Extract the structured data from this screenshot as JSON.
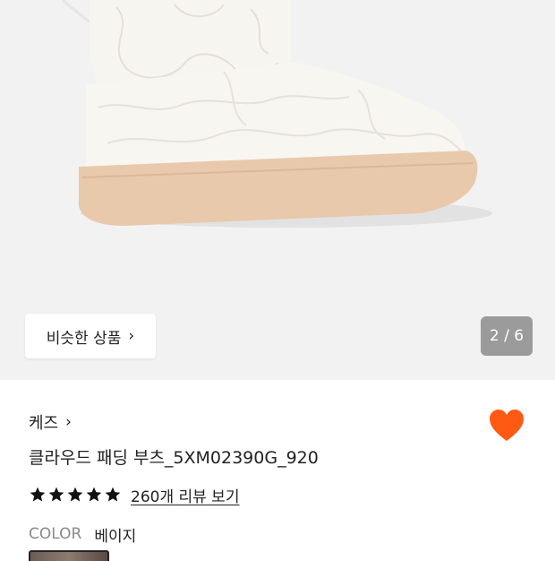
{
  "gallery": {
    "similar_button_label": "비슷한 상품",
    "pager_text": "2 / 6",
    "current_image": 2,
    "total_images": 6
  },
  "product": {
    "brand": "케즈",
    "title": "클라우드 패딩 부츠_5XM02390G_920",
    "rating_stars": 5,
    "review_link": "260개 리뷰 보기",
    "color_label": "COLOR",
    "color_value": "베이지",
    "wishlisted": true
  },
  "colors": {
    "heart": "#ff5a14",
    "star": "#111111",
    "hero_bg": "#f2f2f2",
    "boot_upper": "#f5f2ea",
    "boot_sole": "#e9c9ac",
    "pager_bg": "#9b9b9b"
  },
  "icons": {
    "chevron": "chevron-right-icon",
    "heart": "heart-icon",
    "star": "star-icon"
  }
}
